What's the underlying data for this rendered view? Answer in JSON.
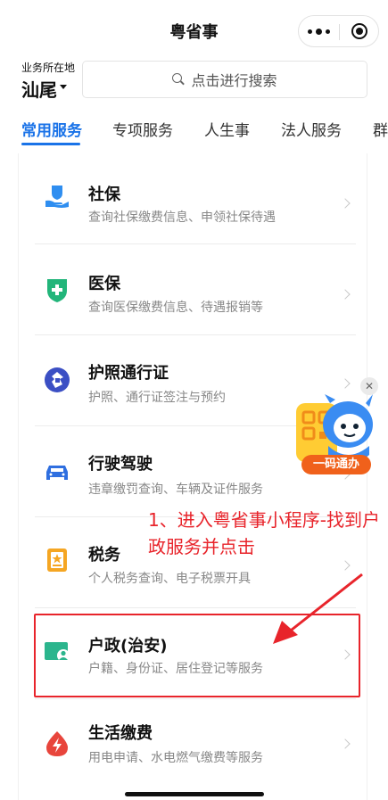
{
  "header": {
    "title": "粤省事"
  },
  "location": {
    "label": "业务所在地",
    "city": "汕尾"
  },
  "search": {
    "placeholder": "点击进行搜索"
  },
  "tabs": [
    {
      "label": "常用服务",
      "active": true
    },
    {
      "label": "专项服务"
    },
    {
      "label": "人生事"
    },
    {
      "label": "法人服务"
    },
    {
      "label": "群"
    }
  ],
  "services": [
    {
      "icon": "hand-shield-icon",
      "title": "社保",
      "desc": "查询社保缴费信息、申领社保待遇"
    },
    {
      "icon": "medical-shield-icon",
      "title": "医保",
      "desc": "查询医保缴费信息、待遇报销等"
    },
    {
      "icon": "passport-icon",
      "title": "护照通行证",
      "desc": "护照、通行证签注与预约"
    },
    {
      "icon": "car-icon",
      "title": "行驶驾驶",
      "desc": "违章缴罚查询、车辆及证件服务"
    },
    {
      "icon": "tax-icon",
      "title": "税务",
      "desc": "个人税务查询、电子税票开具"
    },
    {
      "icon": "id-card-icon",
      "title": "户政(治安)",
      "desc": "户籍、身份证、居住登记等服务"
    },
    {
      "icon": "utility-icon",
      "title": "生活缴费",
      "desc": "用电申请、水电燃气缴费等服务"
    }
  ],
  "promo": {
    "label": "一码通办"
  },
  "annotation": {
    "text": "1、进入粤省事小程序-找到户政服务并点击"
  },
  "colors": {
    "accent": "#1a73e8",
    "annotation": "#e8242b",
    "promo": "#f0611b"
  }
}
